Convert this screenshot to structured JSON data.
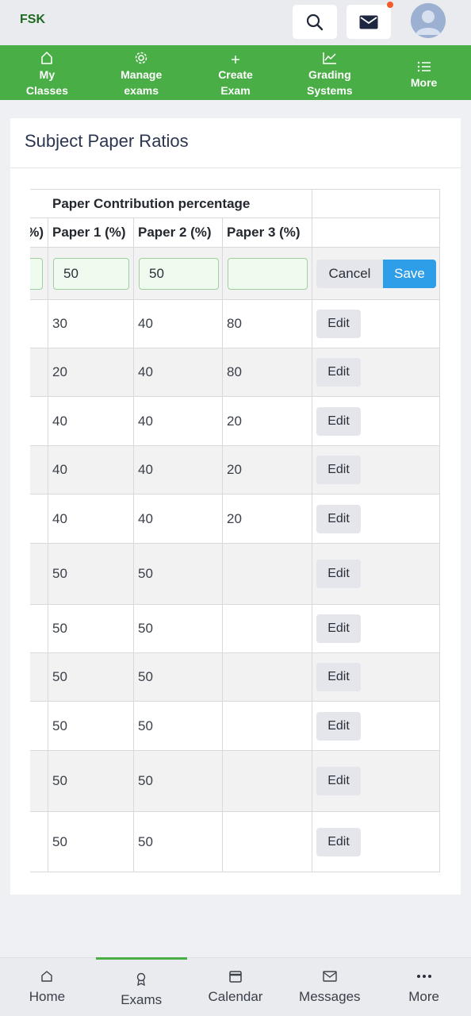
{
  "header": {
    "brand": "FSK"
  },
  "topnav": [
    {
      "icon": "home-outline-icon",
      "line1": "My",
      "line2": "Classes"
    },
    {
      "icon": "gear-icon",
      "line1": "Manage",
      "line2": "exams"
    },
    {
      "icon": "plus-icon",
      "line1": "Create",
      "line2": "Exam"
    },
    {
      "icon": "chart-line-icon",
      "line1": "Grading",
      "line2": "Systems"
    },
    {
      "icon": "list-icon",
      "line1": "More",
      "line2": ""
    }
  ],
  "card": {
    "title": "Subject Paper Ratios"
  },
  "table": {
    "group_header": "Paper Contribution percentage",
    "columns": [
      "%)",
      "Paper 1 (%)",
      "Paper 2 (%)",
      "Paper 3 (%)"
    ],
    "edit_row": {
      "paper1": "50",
      "paper2": "50",
      "paper3": "",
      "cancel_label": "Cancel",
      "save_label": "Save"
    },
    "rows": [
      {
        "paper1": "30",
        "paper2": "40",
        "paper3": "80",
        "action": "Edit"
      },
      {
        "paper1": "20",
        "paper2": "40",
        "paper3": "80",
        "action": "Edit"
      },
      {
        "paper1": "40",
        "paper2": "40",
        "paper3": "20",
        "action": "Edit"
      },
      {
        "paper1": "40",
        "paper2": "40",
        "paper3": "20",
        "action": "Edit"
      },
      {
        "paper1": "40",
        "paper2": "40",
        "paper3": "20",
        "action": "Edit"
      },
      {
        "paper1": "50",
        "paper2": "50",
        "paper3": "",
        "action": "Edit"
      },
      {
        "paper1": "50",
        "paper2": "50",
        "paper3": "",
        "action": "Edit"
      },
      {
        "paper1": "50",
        "paper2": "50",
        "paper3": "",
        "action": "Edit"
      },
      {
        "paper1": "50",
        "paper2": "50",
        "paper3": "",
        "action": "Edit"
      },
      {
        "paper1": "50",
        "paper2": "50",
        "paper3": "",
        "action": "Edit"
      },
      {
        "paper1": "50",
        "paper2": "50",
        "paper3": "",
        "action": "Edit"
      }
    ]
  },
  "bottomnav": [
    {
      "icon": "home-icon",
      "label": "Home",
      "active": false
    },
    {
      "icon": "award-icon",
      "label": "Exams",
      "active": true
    },
    {
      "icon": "calendar-icon",
      "label": "Calendar",
      "active": false
    },
    {
      "icon": "envelope-icon",
      "label": "Messages",
      "active": false
    },
    {
      "icon": "dots-icon",
      "label": "More",
      "active": false
    }
  ],
  "colors": {
    "primary_green": "#4aae47",
    "save_blue": "#2f9ee8",
    "notification": "#f25a2a"
  }
}
